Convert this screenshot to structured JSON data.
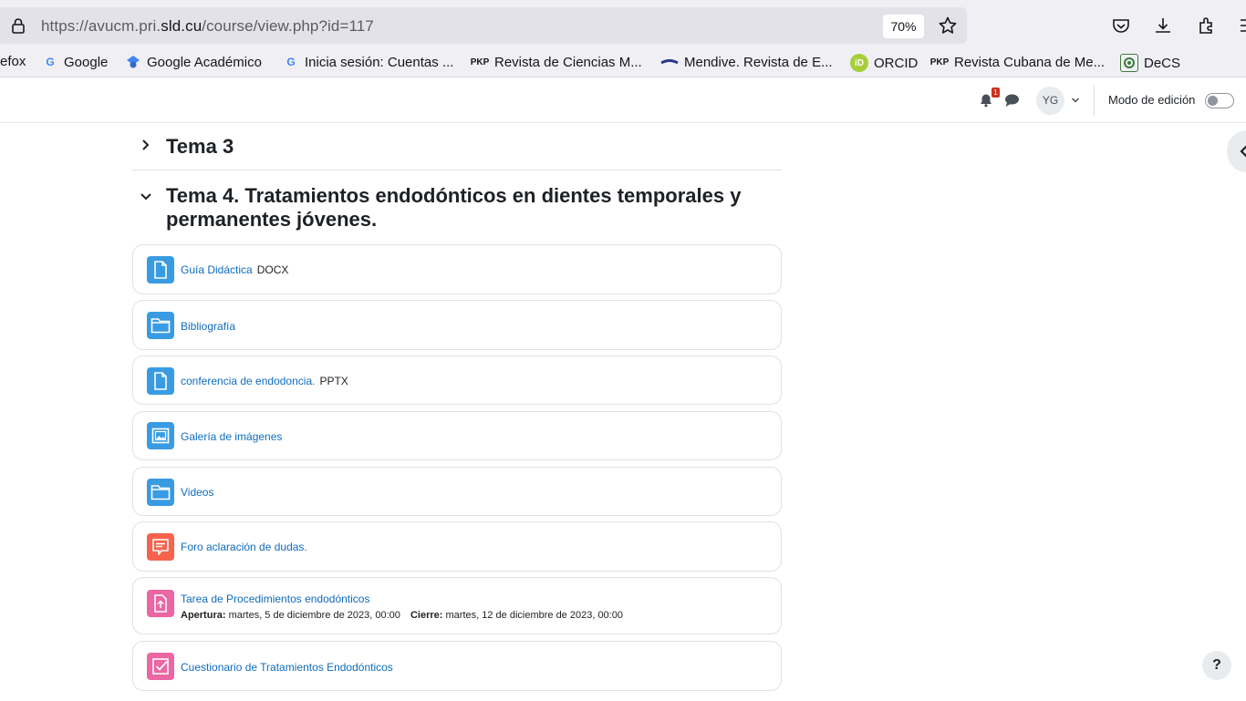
{
  "browser": {
    "url_prefix": "https://avucm.pri.",
    "url_host": "sld.cu",
    "url_path": "/course/view.php?id=117",
    "zoom": "70%",
    "icons": [
      "lock-icon",
      "star-icon",
      "pocket-icon",
      "download-icon",
      "extensions-icon",
      "menu-icon"
    ]
  },
  "bookmarks": [
    {
      "label": "efox",
      "icon": "firefox-icon"
    },
    {
      "label": "Google",
      "icon": "google-icon"
    },
    {
      "label": "Google Académico",
      "icon": "scholar-icon"
    },
    {
      "label": "Inicia sesión: Cuentas ...",
      "icon": "google-icon"
    },
    {
      "label": "Revista de Ciencias M...",
      "icon": "pkp-icon"
    },
    {
      "label": "Mendive. Revista de E...",
      "icon": "mendive-icon"
    },
    {
      "label": "ORCID",
      "icon": "orcid-icon"
    },
    {
      "label": "Revista Cubana de Me...",
      "icon": "pkp-icon"
    },
    {
      "label": "DeCS",
      "icon": "decs-icon"
    }
  ],
  "navbar": {
    "notification_count": "1",
    "avatar_initials": "YG",
    "edit_mode_label": "Modo de edición",
    "edit_mode_on": false
  },
  "sections": [
    {
      "title": "Tema 3",
      "expanded": false
    },
    {
      "title_line1": "Tema 4. Tratamientos endodónticos en dientes temporales y",
      "title_line2": "permanentes jóvenes.",
      "expanded": true
    }
  ],
  "activities": [
    {
      "name": "Guía Didáctica",
      "type": "DOCX",
      "icon": "file-icon",
      "color": "#399be2"
    },
    {
      "name": "Bibliografía",
      "type": "",
      "icon": "folder-icon",
      "color": "#399be2"
    },
    {
      "name": "conferencia de endodoncia.",
      "type": "PPTX",
      "icon": "file-icon",
      "color": "#399be2"
    },
    {
      "name": "Galería de imágenes",
      "type": "",
      "icon": "image-gallery-icon",
      "color": "#399be2"
    },
    {
      "name": "Videos",
      "type": "",
      "icon": "folder-icon",
      "color": "#399be2"
    },
    {
      "name": "Foro aclaración de dudas.",
      "type": "",
      "icon": "forum-icon",
      "color": "#f7634d"
    },
    {
      "name": "Tarea de Procedimientos endodónticos",
      "type": "",
      "icon": "assignment-icon",
      "color": "#eb66a2",
      "open_label": "Apertura:",
      "open_date": "martes, 5 de diciembre de 2023, 00:00",
      "close_label": "Cierre:",
      "close_date": "martes, 12 de diciembre de 2023, 00:00"
    },
    {
      "name": "Cuestionario de Tratamientos Endodónticos",
      "type": "",
      "icon": "quiz-icon",
      "color": "#eb66a2"
    }
  ],
  "help_label": "?"
}
